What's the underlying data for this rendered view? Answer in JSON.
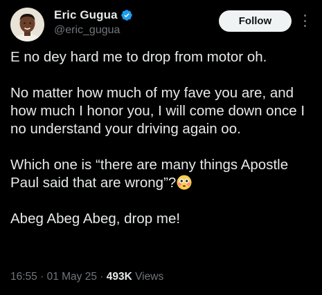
{
  "author": {
    "display_name": "Eric Gugua",
    "handle": "@eric_gugua",
    "verified": true,
    "verified_icon": "verified-badge-icon"
  },
  "actions": {
    "follow_label": "Follow",
    "more_icon": "more-options-icon"
  },
  "tweet": {
    "paragraphs": [
      "E no dey hard me to drop from motor oh.",
      "No matter how much of my fave you are, and how much I honor you, I will come down once I no understand your driving again oo.",
      "Which one is “there are many things Apostle Paul said that are wrong”?",
      "Abeg Abeg Abeg, drop me!"
    ],
    "emoji": "flushed-face-emoji"
  },
  "meta": {
    "time": "16:55",
    "separator": " · ",
    "date": "01 May 25",
    "views_count": "493K",
    "views_label": "Views"
  },
  "colors": {
    "background": "#000000",
    "text_primary": "#e7e9ea",
    "text_secondary": "#71767b",
    "verified_blue": "#1d9bf0",
    "follow_bg": "#eff3f4",
    "follow_text": "#0f1419"
  }
}
